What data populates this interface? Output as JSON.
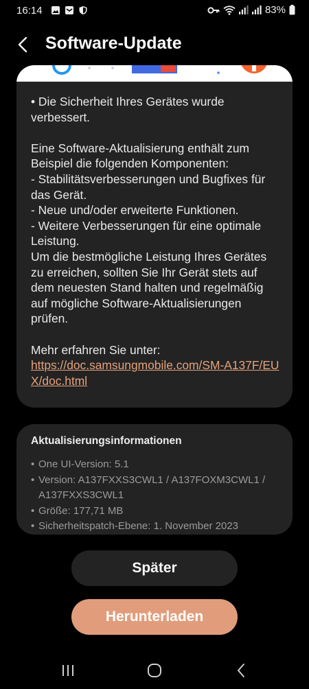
{
  "status_bar": {
    "time": "16:14",
    "battery": "83%"
  },
  "header": {
    "title": "Software-Update"
  },
  "release_notes": {
    "text": "• Die Sicherheit Ihres Gerätes wurde verbessert.\n\nEine Software-Aktualisierung enthält zum Beispiel die folgenden Komponenten:\n - Stabilitätsverbesserungen und Bugfixes für das Gerät.\n - Neue und/oder erweiterte Funktionen.\n - Weitere Verbesserungen für eine optimale Leistung.\nUm die bestmögliche Leistung Ihres Gerätes zu erreichen, sollten Sie Ihr Gerät stets auf dem neuesten Stand halten und regelmäßig auf mögliche Software-Aktualisierungen prüfen.\n\nMehr erfahren Sie unter:",
    "link": "https://doc.samsungmobile.com/SM-A137F/EUX/doc.html"
  },
  "update_info": {
    "title": "Aktualisierungsinformationen",
    "items": [
      "One UI-Version: 5.1",
      "Version: A137FXXS3CWL1 / A137FOXM3CWL1 / A137FXXS3CWL1",
      "Größe: 177,71 MB",
      "Sicherheitspatch-Ebene: 1. November 2023"
    ]
  },
  "buttons": {
    "later": "Später",
    "download": "Herunterladen"
  },
  "colors": {
    "background": "#000000",
    "card": "#232323",
    "accent": "#e19d7b",
    "link": "#e6a27d",
    "secondary_text": "#9b9b9b"
  },
  "icons": [
    "back-arrow-icon",
    "recents-icon",
    "home-icon",
    "back-nav-icon",
    "wifi-icon",
    "signal-icon",
    "battery-icon",
    "key-icon",
    "image-icon",
    "mail-icon",
    "shield-icon"
  ]
}
